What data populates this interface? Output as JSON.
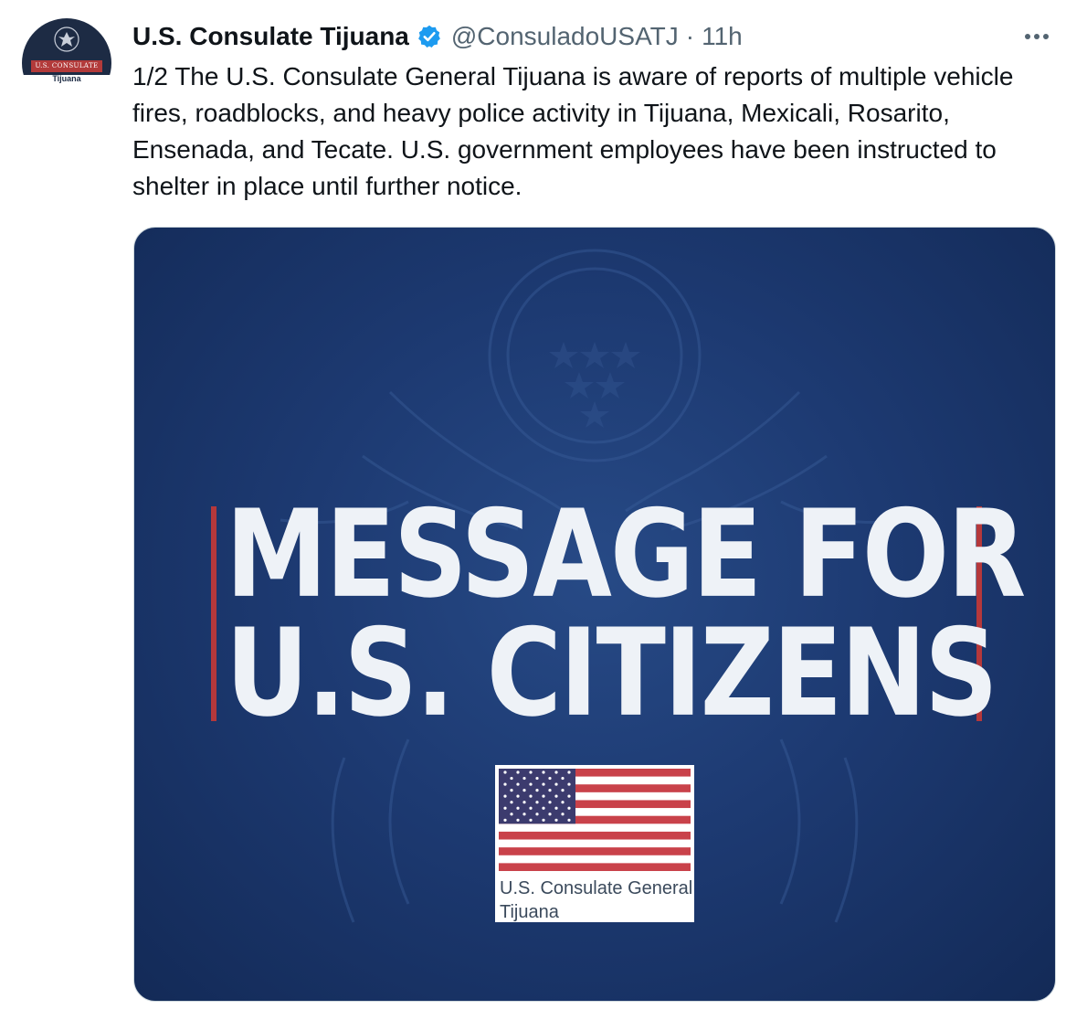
{
  "author": {
    "display_name": "U.S. Consulate Tijuana",
    "handle": "@ConsuladoUSATJ",
    "separator": "·",
    "timestamp": "11h",
    "verified": true,
    "avatar": {
      "band_text": "U.S. CONSULATE",
      "city_text": "Tijuana"
    }
  },
  "tweet": {
    "text": "1/2 The U.S. Consulate General Tijuana is aware of reports of multiple vehicle fires, roadblocks, and heavy police activity in Tijuana, Mexicali, Rosarito, Ensenada, and Tecate. U.S. government employees have been instructed to shelter in place until further notice."
  },
  "media": {
    "headline_line_1": "MESSAGE FOR",
    "headline_line_2": "U.S. CITIZENS",
    "caption_line_1": "U.S. Consulate General",
    "caption_line_2": "Tijuana"
  },
  "icons": {
    "more": "more-options-icon",
    "verified": "verified-badge-icon",
    "seal": "seal-icon",
    "flag": "us-flag-icon"
  },
  "colors": {
    "text_primary": "#0f1419",
    "text_secondary": "#536471",
    "verified_blue": "#1d9bf0",
    "media_blue": "#1d3a72",
    "accent_red": "#b5383b"
  }
}
